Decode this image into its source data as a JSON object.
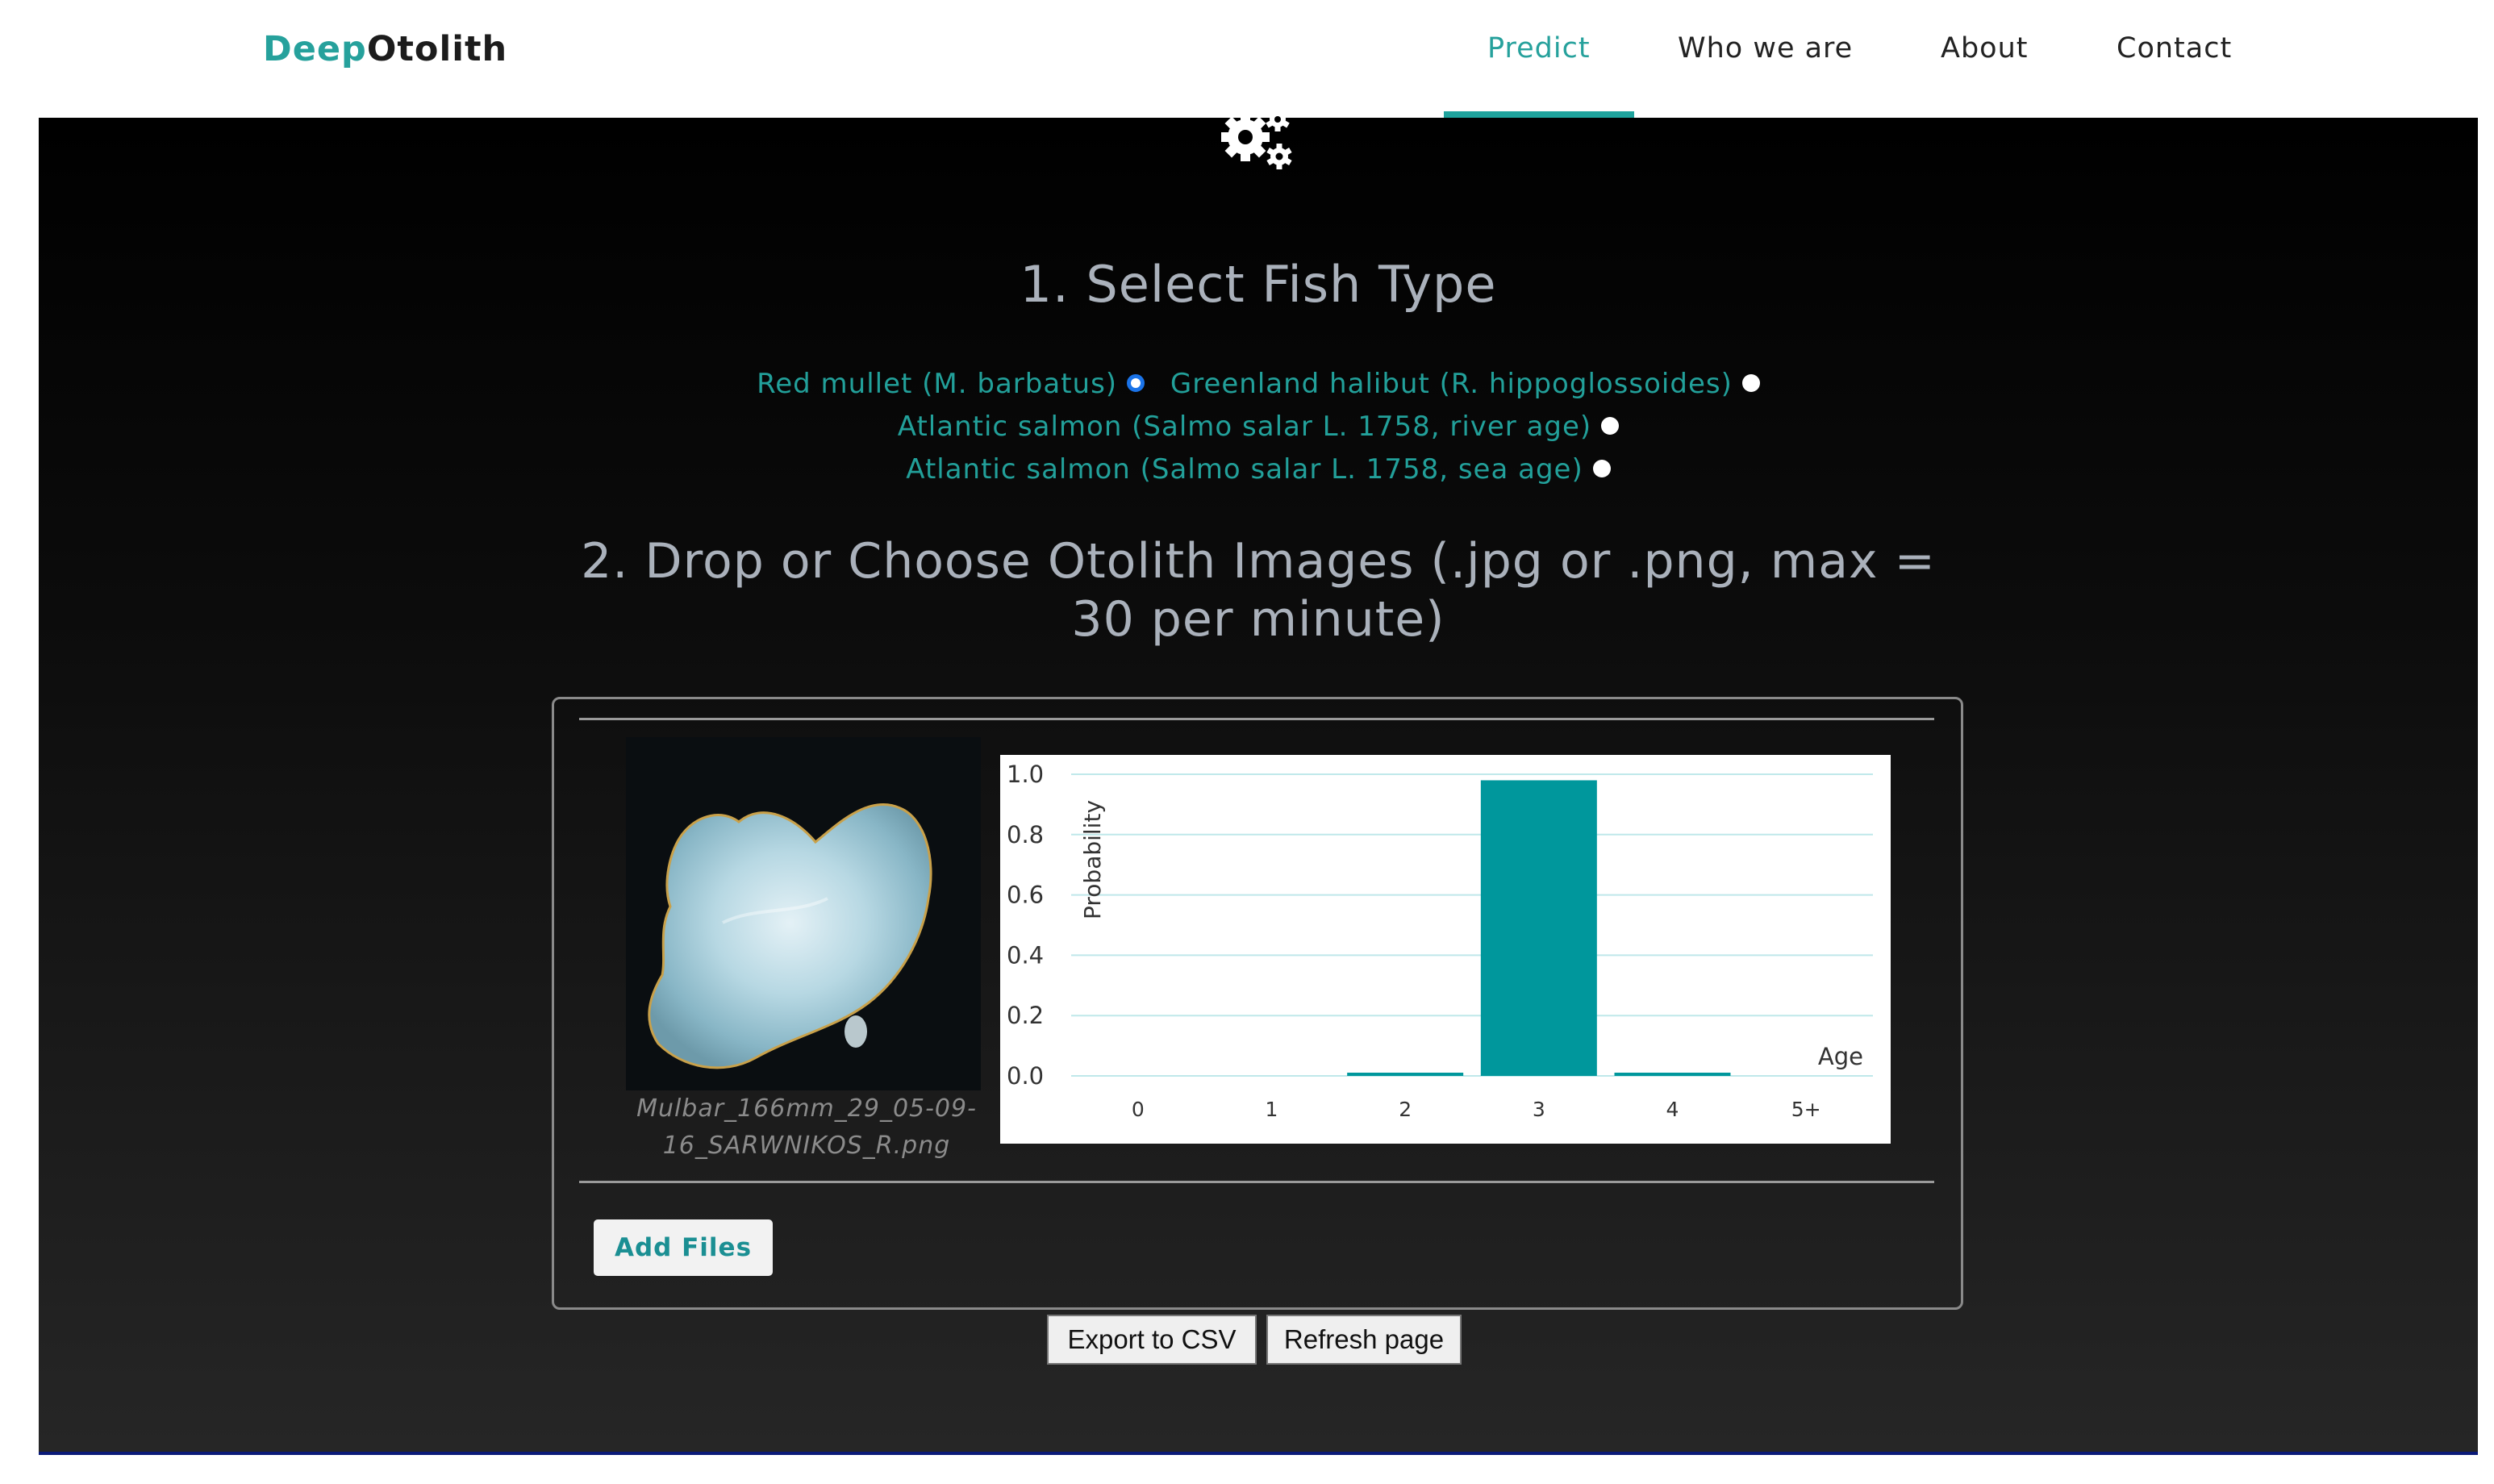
{
  "brand": {
    "part1": "Deep",
    "part2": "Otolith"
  },
  "nav": {
    "predict": "Predict",
    "who": "Who we are",
    "about": "About",
    "contact": "Contact"
  },
  "colors": {
    "accent": "#26a19c",
    "bar": "#00979c"
  },
  "step1": {
    "title": "1. Select Fish Type"
  },
  "fish_options": [
    {
      "label": "Red mullet (M. barbatus)",
      "selected": true
    },
    {
      "label": "Greenland halibut (R. hippoglossoides)",
      "selected": false
    },
    {
      "label": "Atlantic salmon (Salmo salar L. 1758, river age)",
      "selected": false
    },
    {
      "label": "Atlantic salmon (Salmo salar L. 1758, sea age)",
      "selected": false
    }
  ],
  "step2": {
    "title": "2. Drop or Choose Otolith Images (.jpg or .png, max = 30 per minute)"
  },
  "file": {
    "name": "Mulbar_166mm_29_05-09-16_SARWNIKOS_R.png"
  },
  "chart_data": {
    "type": "bar",
    "categories": [
      "0",
      "1",
      "2",
      "3",
      "4",
      "5+"
    ],
    "values": [
      0.0,
      0.0,
      0.01,
      0.98,
      0.01,
      0.0
    ],
    "ylabel": "Probability",
    "xlabel": "Age",
    "ylim": [
      0,
      1.0
    ],
    "yticks": [
      "0.0",
      "0.2",
      "0.4",
      "0.6",
      "0.8",
      "1.0"
    ],
    "grid": true
  },
  "actions": {
    "add_files": "Add Files",
    "export_csv": "Export to CSV",
    "refresh": "Refresh page"
  }
}
